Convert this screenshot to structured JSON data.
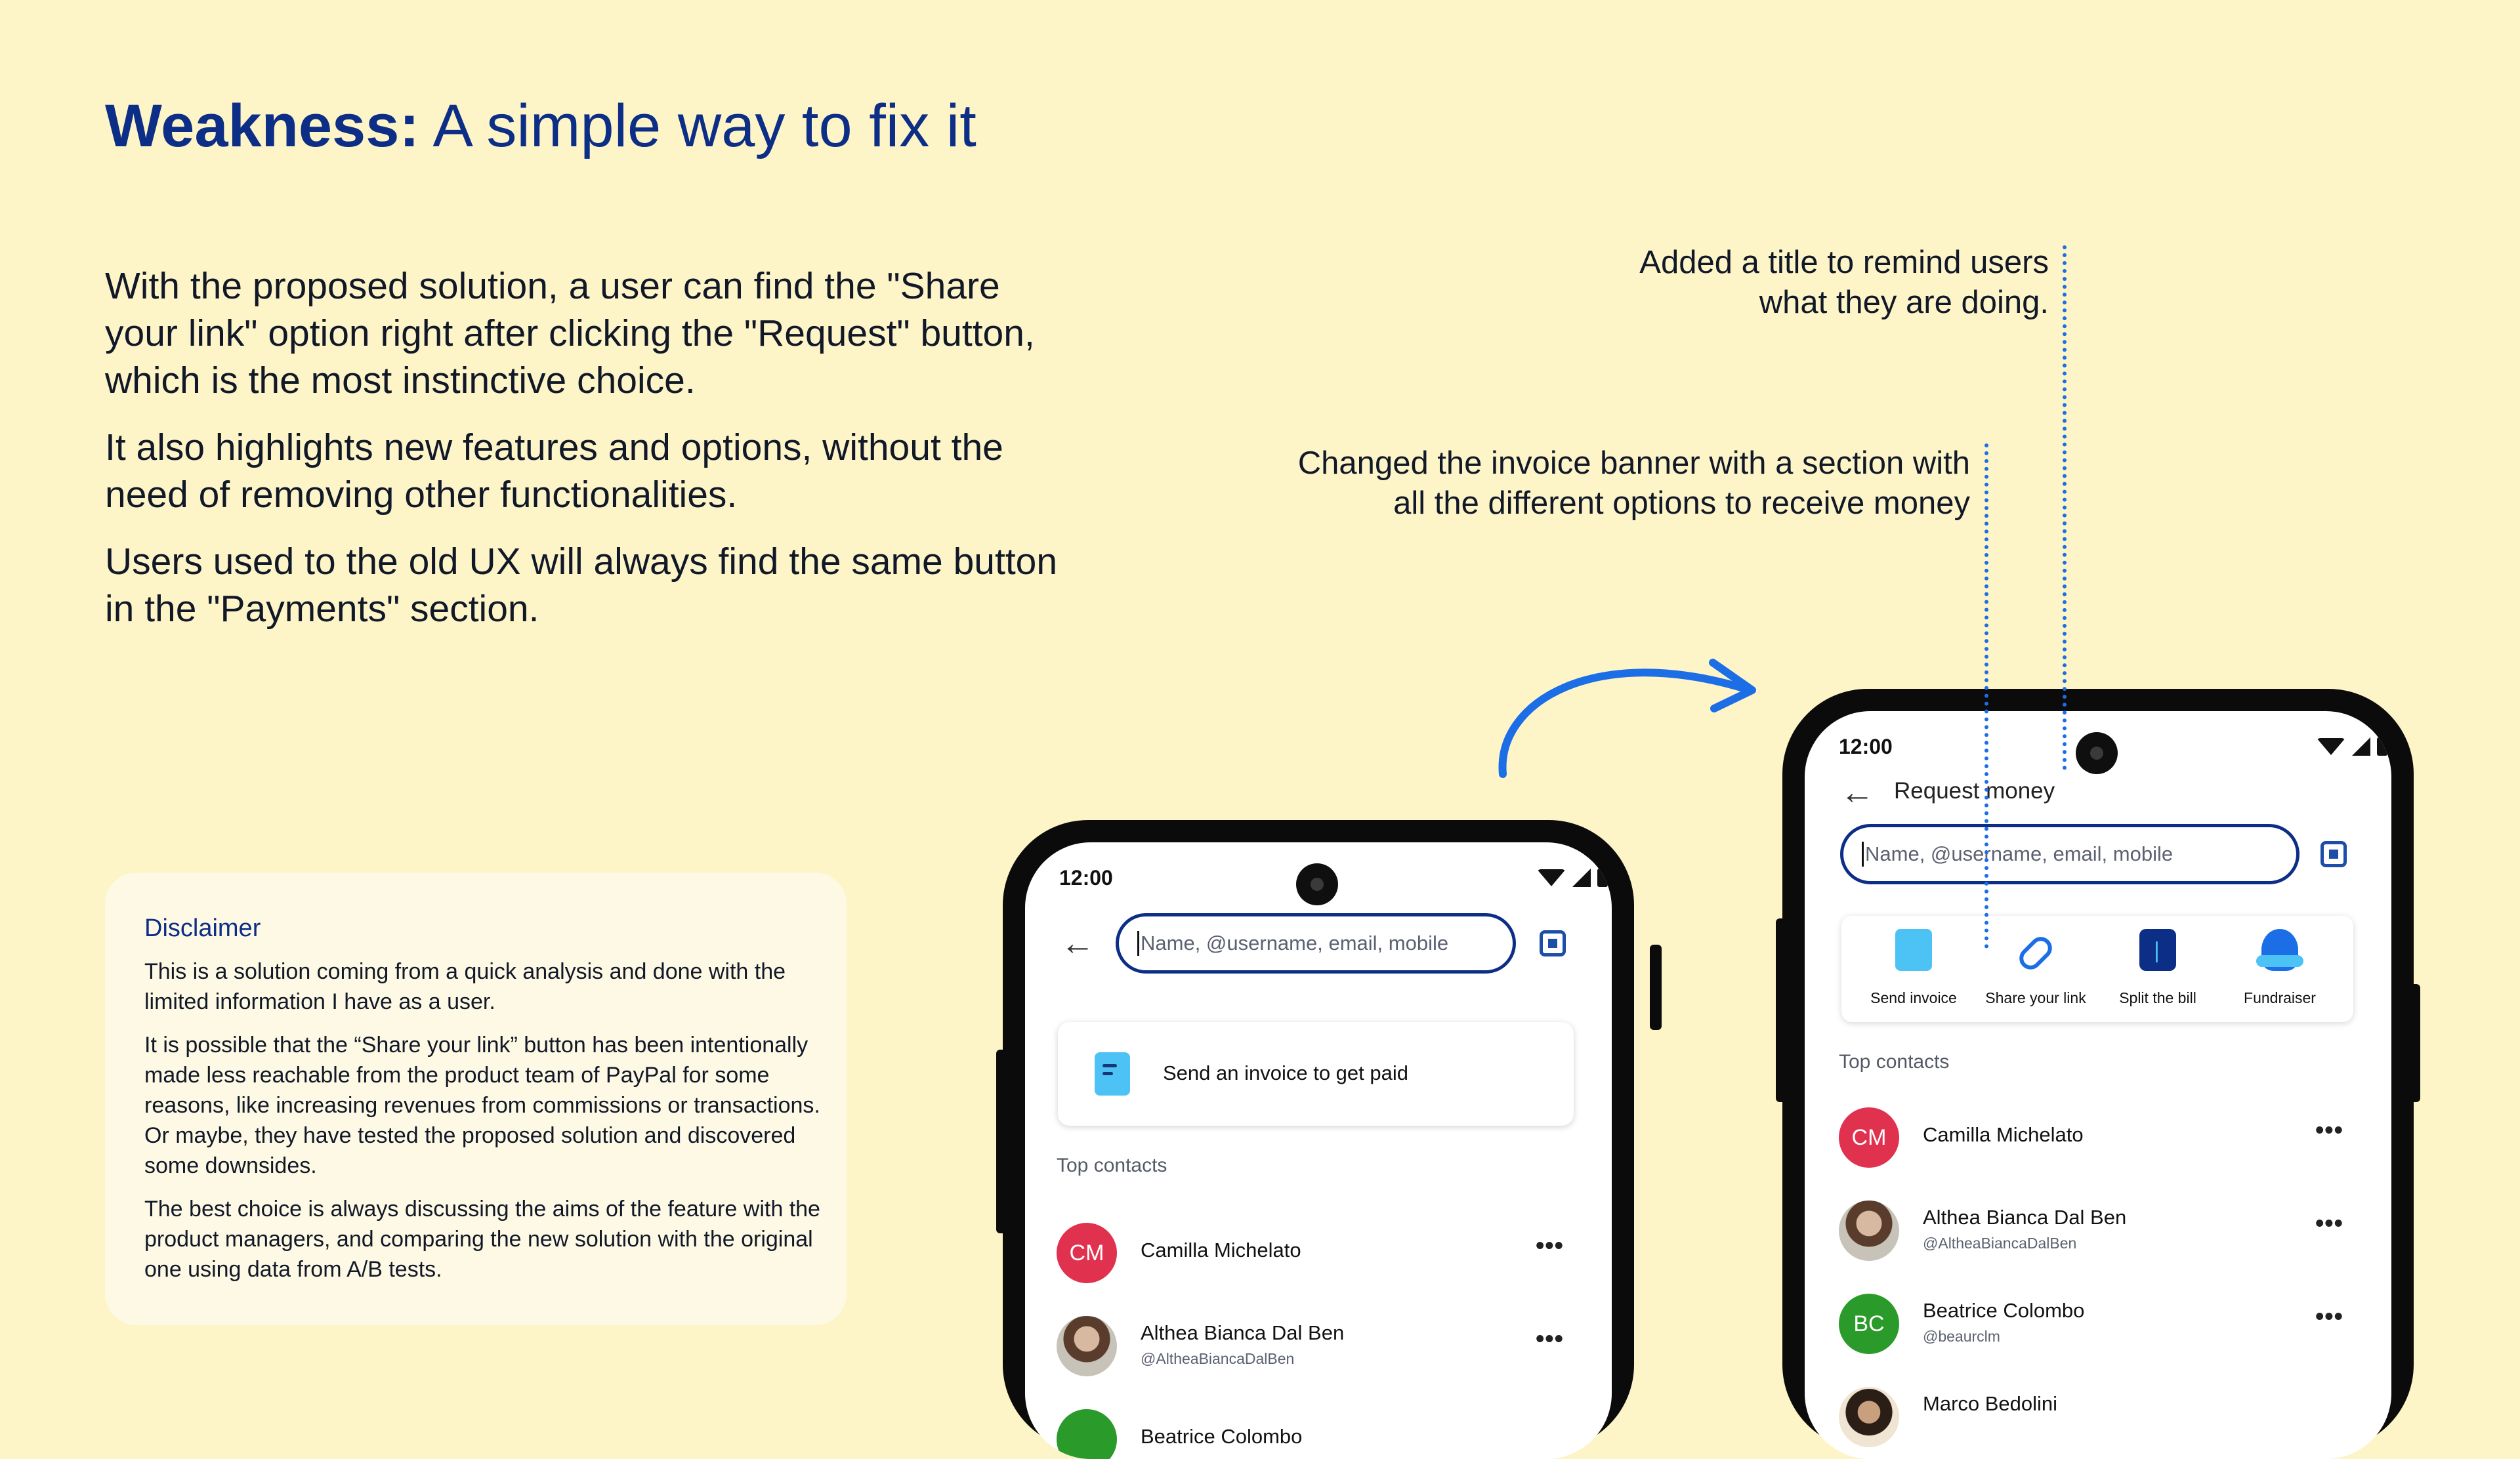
{
  "slide": {
    "title_bold": "Weakness:",
    "title_light": " A simple way to fix it",
    "paragraphs": [
      "With the proposed solution, a user can find the \"Share your link\" option right after clicking the \"Request\" button, which is the most instinctive choice.",
      "It also highlights new features and options, without the need of removing other functionalities.",
      "Users used to the old UX will always find the same button in the \"Payments\" section."
    ]
  },
  "disclaimer": {
    "title": "Disclaimer",
    "paragraphs": [
      "This is a solution coming from a quick analysis and done with the limited information I have as a user.",
      "It is possible that the “Share your link” button has been intentionally made less reachable from the product team of PayPal for some reasons, like increasing revenues from commissions or transactions. Or maybe, they have tested the proposed solution and discovered some downsides.",
      "The best choice is always discussing the aims of the feature with the product managers, and comparing the new solution with the original one using data from A/B tests."
    ]
  },
  "annotations": {
    "note_title": [
      "Added a title to remind users",
      "what they are doing."
    ],
    "note_banner": [
      "Changed the invoice banner with a section with",
      "all the different options to receive money"
    ]
  },
  "colors": {
    "background": "#fdf4c8",
    "title_blue": "#0c2e86",
    "accent_blue": "#1c6ee6",
    "avatar_red": "#e0314f",
    "avatar_green": "#2a9a2a"
  },
  "phone_old": {
    "time": "12:00",
    "search_placeholder": "Name, @username, email, mobile",
    "invoice_banner": "Send an invoice to get paid",
    "top_contacts_label": "Top contacts",
    "contacts": [
      {
        "initials": "CM",
        "name": "Camilla Michelato",
        "handle": ""
      },
      {
        "initials": "",
        "name": "Althea Bianca Dal Ben",
        "handle": "@AltheaBiancaDalBen"
      },
      {
        "initials": "",
        "name": "Beatrice Colombo",
        "handle": ""
      }
    ],
    "more_icon": "•••"
  },
  "phone_new": {
    "time": "12:00",
    "page_title": "Request money",
    "search_placeholder": "Name, @username, email, mobile",
    "options": [
      {
        "label": "Send invoice",
        "icon": "invoice-icon"
      },
      {
        "label": "Share your link",
        "icon": "link-icon"
      },
      {
        "label": "Split the bill",
        "icon": "split-bill-icon"
      },
      {
        "label": "Fundraiser",
        "icon": "fundraiser-icon"
      }
    ],
    "top_contacts_label": "Top contacts",
    "contacts": [
      {
        "initials": "CM",
        "name": "Camilla Michelato",
        "handle": ""
      },
      {
        "initials": "",
        "name": "Althea Bianca Dal Ben",
        "handle": "@AltheaBiancaDalBen"
      },
      {
        "initials": "BC",
        "name": "Beatrice Colombo",
        "handle": "@beaurclm"
      },
      {
        "initials": "",
        "name": "Marco Bedolini",
        "handle": ""
      }
    ],
    "more_icon": "•••"
  }
}
